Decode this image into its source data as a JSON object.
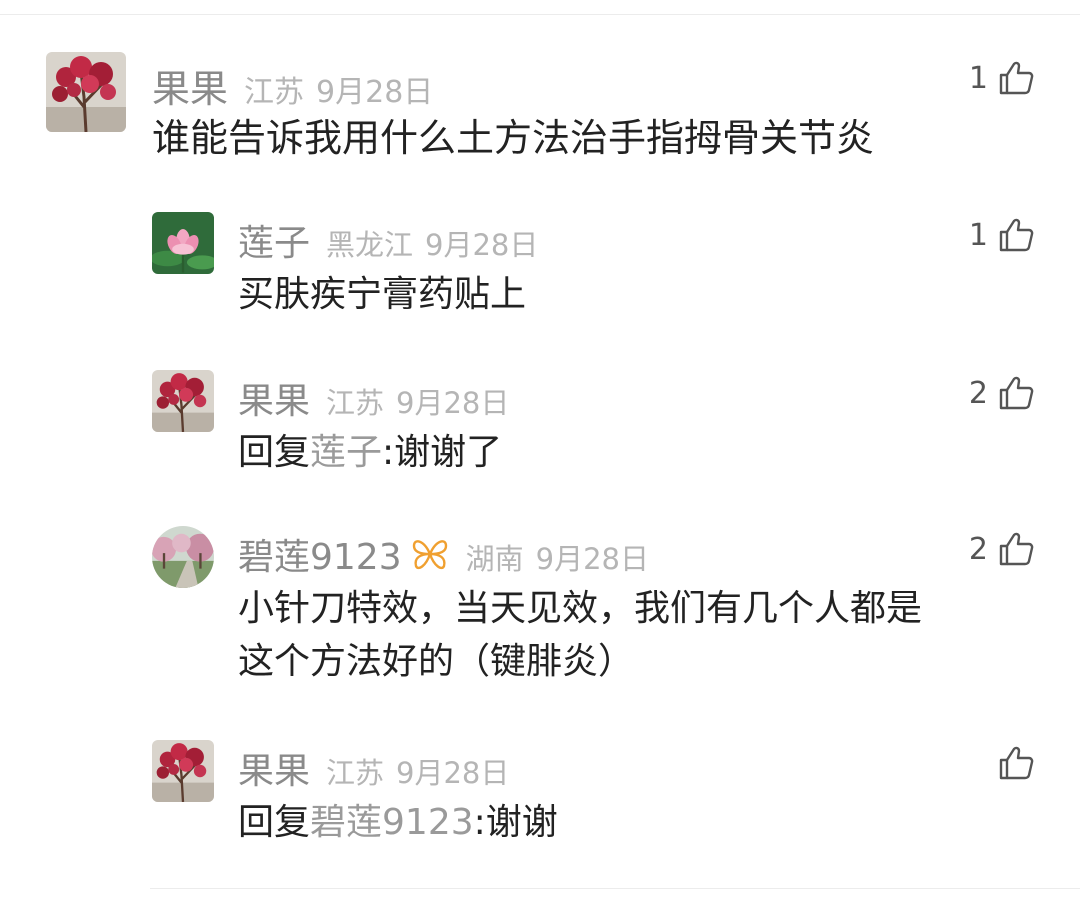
{
  "comments": [
    {
      "user": "果果",
      "region": "江苏",
      "date": "9月28日",
      "likes": "1",
      "text": "谁能告诉我用什么土方法治手指拇骨关节炎",
      "avatar": "red-blossom-tree-icon"
    },
    {
      "user": "莲子",
      "region": "黑龙江",
      "date": "9月28日",
      "likes": "1",
      "text": "买肤疾宁膏药贴上",
      "avatar": "lotus-flower-icon"
    },
    {
      "user": "果果",
      "region": "江苏",
      "date": "9月28日",
      "likes": "2",
      "reply_prefix": "回复",
      "reply_to": "莲子",
      "text": ":谢谢了",
      "avatar": "red-blossom-tree-icon"
    },
    {
      "user": "碧莲9123",
      "region": "湖南",
      "date": "9月28日",
      "likes": "2",
      "text_line1": "小针刀特效，当天见效，我们有几个人都是",
      "text_line2": "这个方法好的（键腓炎）",
      "avatar": "park-path-icon",
      "badge": "vip-butterfly-icon"
    },
    {
      "user": "果果",
      "region": "江苏",
      "date": "9月28日",
      "likes": "",
      "reply_prefix": "回复",
      "reply_to": "碧莲9123",
      "text": ":谢谢",
      "avatar": "red-blossom-tree-icon"
    }
  ],
  "colors": {
    "username": "#8a8a8a",
    "meta": "#b5b5b5",
    "text": "#222222",
    "mention": "#9a9a9a",
    "badge": "#f0a030"
  }
}
